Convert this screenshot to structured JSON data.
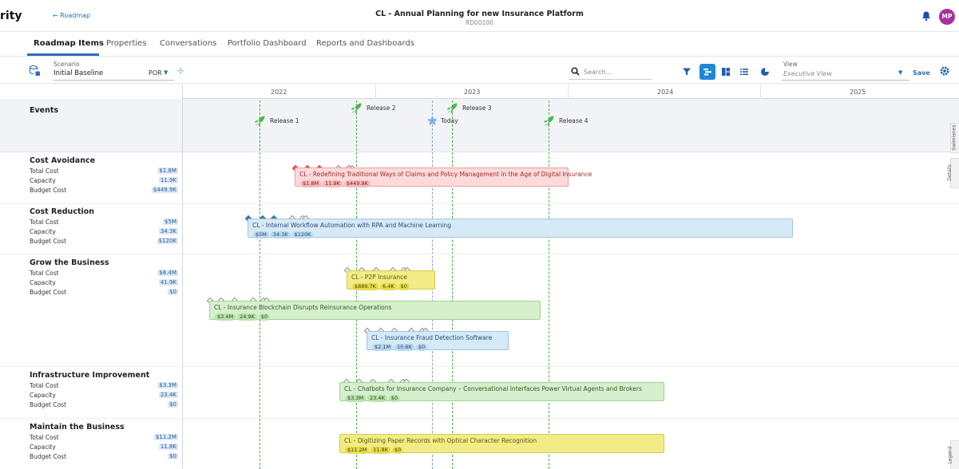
{
  "header": {
    "brand": "rity",
    "back_link": "← Roadmap",
    "title": "CL - Annual Planning for new Insurance Platform",
    "subtitle": "RD00100",
    "avatar": "MP"
  },
  "tabs": [
    {
      "label": "Roadmap Items",
      "active": true
    },
    {
      "label": "Properties",
      "active": false
    },
    {
      "label": "Conversations",
      "active": false
    },
    {
      "label": "Portfolio Dashboard",
      "active": false
    },
    {
      "label": "Reports and Dashboards",
      "active": false
    }
  ],
  "toolbar": {
    "scenario_label": "Scenario",
    "scenario_value": "Initial Baseline",
    "scenario_option": "POR",
    "search_placeholder": "Search...",
    "view_label": "View",
    "view_value": "Executive View",
    "save_label": "Save"
  },
  "timeline": {
    "years": [
      "2022",
      "2023",
      "2024",
      "2025"
    ],
    "events_label": "Events",
    "milestones": [
      {
        "label": "Release 1",
        "type": "release"
      },
      {
        "label": "Release 2",
        "type": "release"
      },
      {
        "label": "Release 3",
        "type": "release"
      },
      {
        "label": "Today",
        "type": "today"
      },
      {
        "label": "Release 4",
        "type": "release"
      }
    ]
  },
  "metric_labels": {
    "total": "Total Cost",
    "capacity": "Capacity",
    "budget": "Budget Cost"
  },
  "groups": [
    {
      "name": "Cost Avoidance",
      "total": "$1.8M",
      "capacity": "11.9K",
      "budget": "$449.9K",
      "items": [
        {
          "title": "CL - Redefining Traditional Ways of Claims and Policy Management in the Age of Digital Insurance",
          "color": "red",
          "chips": [
            "$1.8M",
            "11.9K",
            "$449.9K"
          ]
        }
      ]
    },
    {
      "name": "Cost Reduction",
      "total": "$5M",
      "capacity": "34.3K",
      "budget": "$120K",
      "items": [
        {
          "title": "CL - Internal Workflow Automation with RPA and Machine Learning",
          "color": "blue",
          "chips": [
            "$5M",
            "34.3K",
            "$120K"
          ]
        }
      ]
    },
    {
      "name": "Grow the Business",
      "total": "$6.4M",
      "capacity": "41.9K",
      "budget": "$0",
      "items": [
        {
          "title": "CL - P2P Insurance",
          "color": "yellow",
          "chips": [
            "$889.7K",
            "6.4K",
            "$0"
          ]
        },
        {
          "title": "CL - Insurance Blockchain Disrupts Reinsurance Operations",
          "color": "green",
          "chips": [
            "$3.4M",
            "24.9K",
            "$0"
          ]
        },
        {
          "title": "CL - Insurance Fraud Detection Software",
          "color": "blue",
          "chips": [
            "$2.1M",
            "10.6K",
            "$0"
          ]
        }
      ]
    },
    {
      "name": "Infrastructure Improvement",
      "total": "$3.3M",
      "capacity": "23.4K",
      "budget": "$0",
      "items": [
        {
          "title": "CL - Chatbots for Insurance Company – Conversational Interfaces Power Virtual Agents and Brokers",
          "color": "green",
          "chips": [
            "$3.3M",
            "23.4K",
            "$0"
          ]
        }
      ]
    },
    {
      "name": "Maintain the Business",
      "total": "$11.2M",
      "capacity": "11.8K",
      "budget": "$0",
      "items": [
        {
          "title": "CL - Digitizing Paper Records with Optical Character Recognition",
          "color": "yellow",
          "chips": [
            "$11.2M",
            "11.8K",
            "$0"
          ]
        }
      ]
    }
  ],
  "side_tabs": [
    "Swimlanes",
    "Details",
    "Legend"
  ],
  "colors": {
    "accent": "#1e88d6",
    "release_line": "#42b83a",
    "today_line": "#7fa8d8",
    "avatar": "#a8309a"
  },
  "icons": [
    "bell-icon",
    "search-icon",
    "filter-icon",
    "gantt-view-icon",
    "board-view-icon",
    "list-view-icon",
    "pie-chart-icon",
    "gear-icon",
    "rocket-icon",
    "star-icon",
    "scenario-icon",
    "pin-icon"
  ]
}
